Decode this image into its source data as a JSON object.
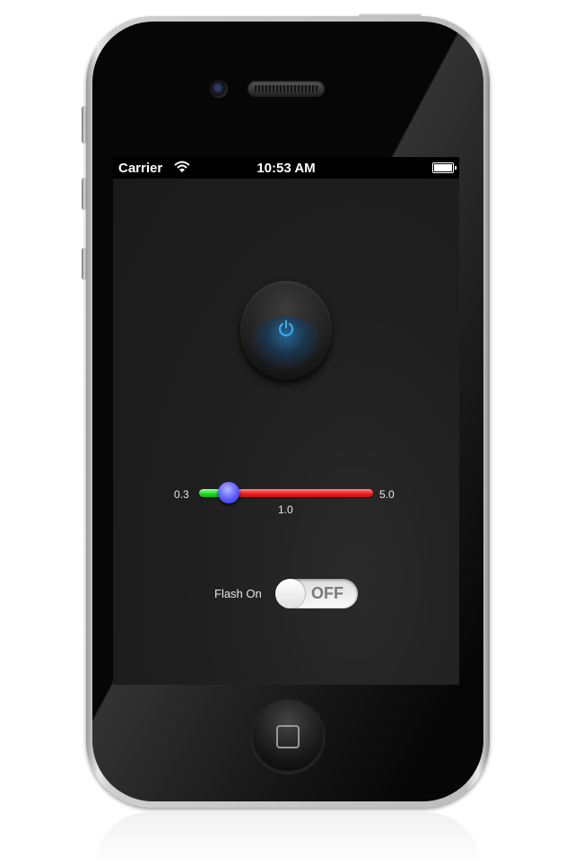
{
  "status_bar": {
    "carrier": "Carrier",
    "time": "10:53 AM",
    "wifi_icon": "wifi-icon",
    "battery_icon": "battery-icon"
  },
  "power_button": {
    "icon": "power-icon",
    "accent_color": "#2ea7ff"
  },
  "slider": {
    "min_label": "0.3",
    "max_label": "5.0",
    "value_label": "1.0",
    "min": 0.3,
    "max": 5.0,
    "value": 1.0,
    "min_track_color": "#22dd22",
    "max_track_color": "#ee2020",
    "thumb_color": "#5b5bff"
  },
  "flash": {
    "label": "Flash On",
    "toggle_text": "OFF",
    "is_on": false
  },
  "home_button_icon": "home-square-icon"
}
